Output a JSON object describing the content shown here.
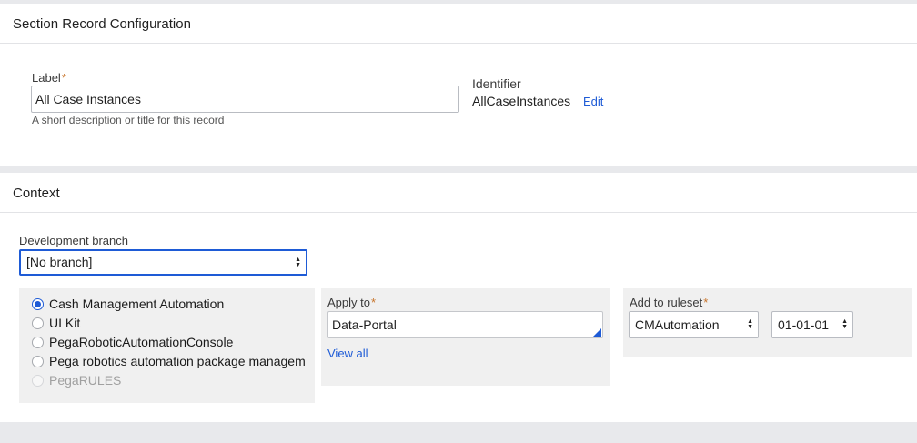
{
  "record_config": {
    "title": "Section Record Configuration",
    "label_field": {
      "label": "Label",
      "required_marker": "*",
      "value": "All Case Instances",
      "helper": "A short description or title for this record"
    },
    "identifier": {
      "label": "Identifier",
      "value": "AllCaseInstances",
      "edit_link": "Edit"
    }
  },
  "context": {
    "title": "Context",
    "dev_branch": {
      "label": "Development branch",
      "selected": "[No branch]"
    },
    "applications": [
      {
        "label": "Cash Management Automation",
        "checked": true,
        "disabled": false
      },
      {
        "label": "UI Kit",
        "checked": false,
        "disabled": false
      },
      {
        "label": "PegaRoboticAutomationConsole",
        "checked": false,
        "disabled": false
      },
      {
        "label": "Pega robotics automation package managem",
        "checked": false,
        "disabled": false
      },
      {
        "label": "PegaRULES",
        "checked": false,
        "disabled": true
      }
    ],
    "apply_to": {
      "label": "Apply to",
      "required_marker": "*",
      "value": "Data-Portal",
      "view_all_link": "View all"
    },
    "ruleset": {
      "label": "Add to ruleset",
      "required_marker": "*",
      "ruleset_value": "CMAutomation",
      "version_value": "01-01-01"
    }
  },
  "colors": {
    "accent": "#1e5bd6",
    "required": "#c8742a",
    "background": "#e8e9ec"
  }
}
